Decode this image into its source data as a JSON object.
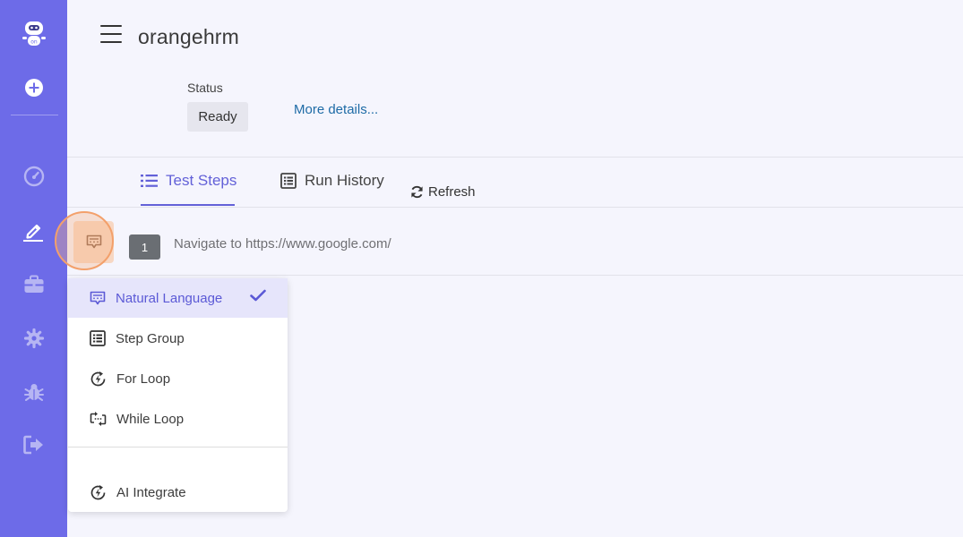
{
  "header": {
    "app_title": "orangehrm"
  },
  "status": {
    "label": "Status",
    "value": "Ready",
    "more_link": "More details..."
  },
  "tabs": [
    {
      "label": "Test Steps",
      "active": true,
      "icon": "list-icon"
    },
    {
      "label": "Run History",
      "active": false,
      "icon": "history-icon"
    },
    {
      "label": "Refresh",
      "active": false,
      "icon": "refresh-icon"
    }
  ],
  "steps": [
    {
      "number": "1",
      "text": "Navigate to https://www.google.com/",
      "type_icon": "natural-language-icon"
    }
  ],
  "step_type_menu": {
    "items": [
      {
        "label": "Natural Language",
        "icon": "natural-language-icon",
        "selected": true
      },
      {
        "label": "Step Group",
        "icon": "step-group-icon",
        "selected": false
      },
      {
        "label": "For Loop",
        "icon": "for-loop-icon",
        "selected": false
      },
      {
        "label": "While Loop",
        "icon": "while-loop-icon",
        "selected": false
      },
      {
        "label": "AI Integrate",
        "icon": "ai-integrate-icon",
        "selected": false
      }
    ]
  },
  "sidebar": {
    "items": [
      {
        "icon": "robot-logo-icon"
      },
      {
        "icon": "add-icon"
      },
      {
        "icon": "dashboard-gauge-icon"
      },
      {
        "icon": "edit-pen-icon",
        "active": true
      },
      {
        "icon": "briefcase-icon"
      },
      {
        "icon": "settings-gear-icon"
      },
      {
        "icon": "bug-icon"
      },
      {
        "icon": "logout-icon"
      }
    ]
  },
  "colors": {
    "sidebar": "#6d6be8",
    "accent": "#6361d8",
    "link": "#1e6ba6",
    "highlight": "#f3a06b"
  }
}
